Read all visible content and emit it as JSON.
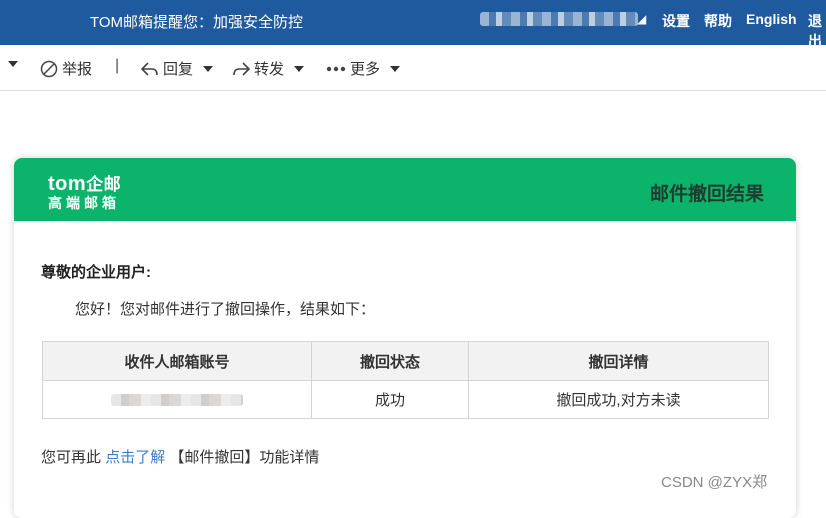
{
  "topbar": {
    "notice": "TOM邮箱提醒您：加强安全防控",
    "caret": "◢",
    "links": [
      "设置",
      "帮助",
      "English",
      "退出"
    ]
  },
  "toolbar": {
    "report": "举报",
    "reply": "回复",
    "forward": "转发",
    "more": "更多"
  },
  "card": {
    "logo_main": "tom",
    "logo_suffix": "企邮",
    "logo_sub": "高端邮箱",
    "title": "邮件撤回结果",
    "greeting": "尊敬的企业用户:",
    "intro": "您好！您对邮件进行了撤回操作，结果如下：",
    "table": {
      "headers": [
        "收件人邮箱账号",
        "撤回状态",
        "撤回详情"
      ],
      "rows": [
        {
          "status": "成功",
          "detail": "撤回成功,对方未读"
        }
      ]
    },
    "footer_prefix": "您可再此",
    "footer_link": "点击了解",
    "footer_suffix": "【邮件撤回】功能详情"
  },
  "watermark": "CSDN @ZYX郑",
  "colors": {
    "topbar": "#1f5a9e",
    "card_header": "#0cb36b",
    "link": "#3d7cc9"
  }
}
